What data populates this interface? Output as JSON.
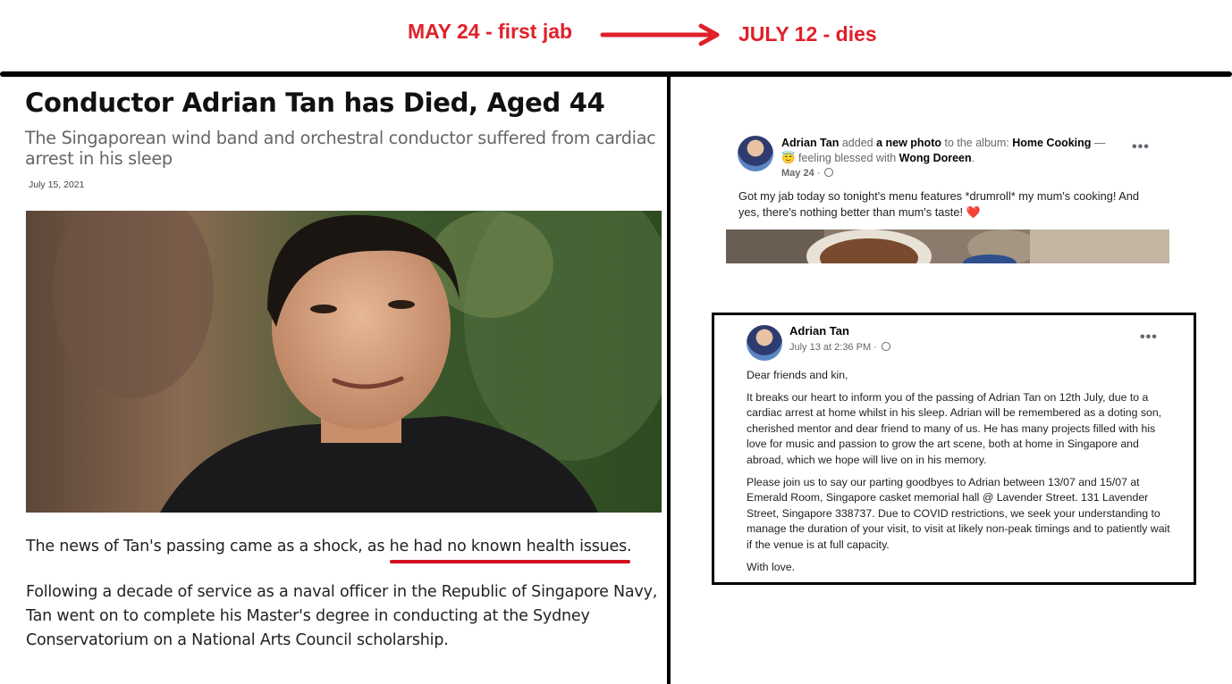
{
  "timeline": {
    "start_label": "MAY 24 - first jab",
    "end_label": "JULY 12 - dies",
    "accent_color": "#e0202a"
  },
  "article": {
    "title": "Conductor Adrian Tan has Died, Aged 44",
    "subtitle": "The Singaporean wind band and orchestral conductor suffered from cardiac arrest in his sleep",
    "date": "July 15, 2021",
    "paragraph1_before": "The news of Tan's passing came as a shock, as ",
    "paragraph1_highlight": "he had no known health issues",
    "paragraph1_after": ".",
    "paragraph2": "Following a decade of service as a naval officer in the Republic of Singapore Navy, Tan went on to complete his Master's degree in conducting at the Sydney Conservatorium on a National Arts Council scholarship."
  },
  "post1": {
    "author": "Adrian Tan",
    "action": " added ",
    "object": "a new photo",
    "album_prefix": " to the album: ",
    "album": "Home Cooking",
    "dash": " —",
    "feeling_emoji": "😇",
    "feeling_text": " feeling blessed with ",
    "tagged": "Wong Doreen",
    "period": ".",
    "date": "May 24",
    "body": "Got my jab today so tonight's menu features *drumroll* my mum's cooking! And yes, there's nothing better than mum's taste! ❤️",
    "menu_icon": "more-dots-icon"
  },
  "post2": {
    "author": "Adrian Tan",
    "date": "July 13 at 2:36 PM",
    "menu_icon": "more-dots-icon",
    "greeting": "Dear friends and kin,",
    "paragraph1": "It breaks our heart to inform you of the passing of Adrian Tan on 12th July, due to a cardiac arrest at home whilst in his sleep. Adrian will be remembered as a doting son, cherished mentor and dear friend to many of us. He has many projects filled with his love for music and passion to grow the art scene, both at home in Singapore and abroad, which we hope will live on in his memory.",
    "paragraph2": "Please join us to say our parting goodbyes to Adrian between 13/07 and 15/07 at Emerald Room, Singapore casket memorial hall @ Lavender Street. 131 Lavender Street, Singapore 338737. Due to COVID restrictions, we seek your understanding to manage the duration of your visit, to visit at likely non-peak timings and to patiently wait if the venue is at full capacity.",
    "closing": "With love."
  }
}
